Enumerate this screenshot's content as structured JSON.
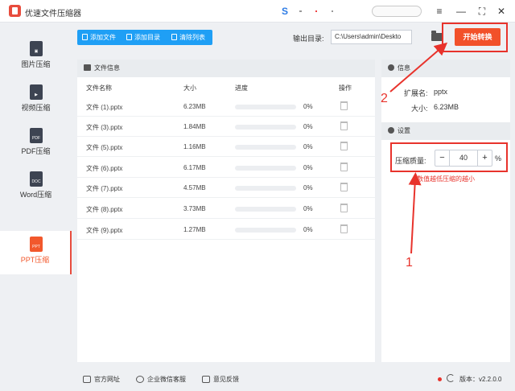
{
  "app": {
    "title": "优速文件压缩器"
  },
  "window": {
    "menu_glyph": "≡",
    "min_glyph": "—",
    "max_glyph": "⛶",
    "close_glyph": "✕"
  },
  "sidebar": {
    "items": [
      {
        "label": "图片压缩",
        "icon": "image-file-icon",
        "tag": ""
      },
      {
        "label": "视频压缩",
        "icon": "video-file-icon",
        "tag": "▶"
      },
      {
        "label": "PDF压缩",
        "icon": "pdf-file-icon",
        "tag": "PDF"
      },
      {
        "label": "Word压缩",
        "icon": "doc-file-icon",
        "tag": "DOC"
      },
      {
        "label": "PPT压缩",
        "icon": "ppt-file-icon",
        "tag": "PPT",
        "active": true
      }
    ]
  },
  "toolbar": {
    "add_file": "添加文件",
    "add_dir": "添加目录",
    "clear_list": "清除列表",
    "output_label": "输出目录:",
    "output_path": "C:\\Users\\admin\\Deskto",
    "start": "开始转换"
  },
  "file_panel": {
    "title": "文件信息",
    "columns": {
      "name": "文件名称",
      "size": "大小",
      "progress": "进度",
      "action": "操作"
    },
    "rows": [
      {
        "name": "文件 (1).pptx",
        "size": "6.23MB",
        "progress_text": "0%",
        "progress": 0
      },
      {
        "name": "文件 (3).pptx",
        "size": "1.84MB",
        "progress_text": "0%",
        "progress": 0
      },
      {
        "name": "文件 (5).pptx",
        "size": "1.16MB",
        "progress_text": "0%",
        "progress": 0
      },
      {
        "name": "文件 (6).pptx",
        "size": "6.17MB",
        "progress_text": "0%",
        "progress": 0
      },
      {
        "name": "文件 (7).pptx",
        "size": "4.57MB",
        "progress_text": "0%",
        "progress": 0
      },
      {
        "name": "文件 (8).pptx",
        "size": "3.73MB",
        "progress_text": "0%",
        "progress": 0
      },
      {
        "name": "文件 (9).pptx",
        "size": "1.27MB",
        "progress_text": "0%",
        "progress": 0
      }
    ]
  },
  "info_panel": {
    "title": "信息",
    "ext_label": "扩展名:",
    "ext_value": "pptx",
    "size_label": "大小:",
    "size_value": "6.23MB",
    "settings_title": "设置",
    "quality_label": "压缩质量:",
    "quality_value": "40",
    "minus": "−",
    "plus": "+",
    "pct": "%",
    "hint": "数值越低压缩的越小"
  },
  "annotations": {
    "one": "1",
    "two": "2",
    "color": "#e8332c"
  },
  "footer": {
    "website": "官方网址",
    "wechat": "企业微信客服",
    "feedback": "意见反馈",
    "version": "版本：v2.2.0.0"
  },
  "colors": {
    "accent_blue": "#1f9ff5",
    "start_orange": "#f2512a",
    "active_red": "#f2582c"
  }
}
